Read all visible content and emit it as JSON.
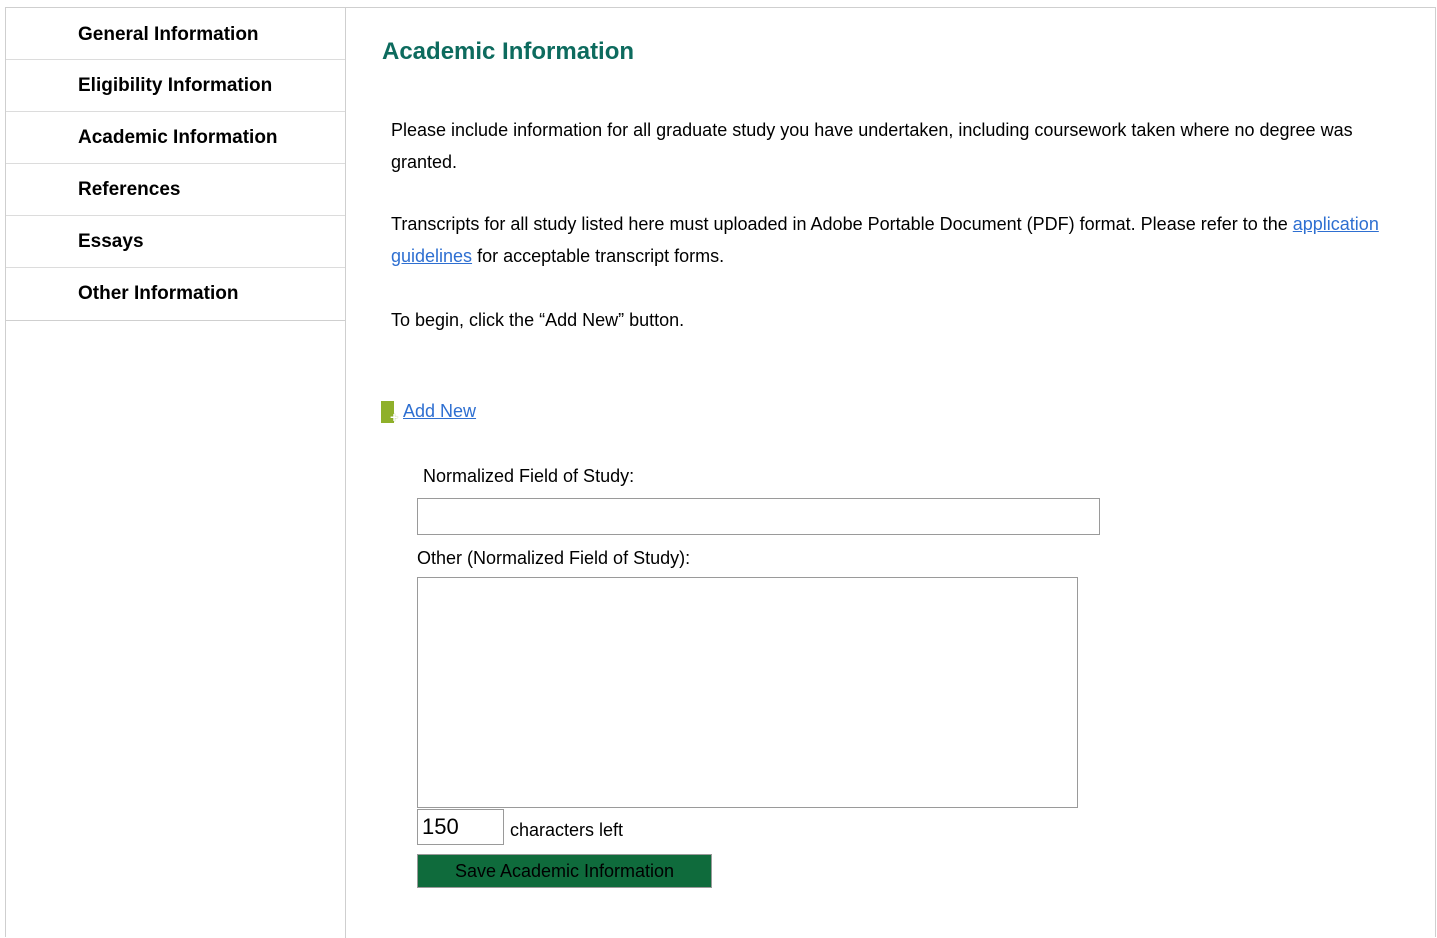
{
  "sidebar": {
    "items": [
      {
        "label": "General Information"
      },
      {
        "label": "Eligibility Information"
      },
      {
        "label": "Academic Information"
      },
      {
        "label": "References"
      },
      {
        "label": "Essays"
      },
      {
        "label": "Other Information"
      }
    ]
  },
  "main": {
    "title": "Academic Information",
    "intro": "Please include information for all graduate study you have undertaken, including coursework taken where no degree was granted.",
    "transcripts_before": "Transcripts for all study listed here must uploaded in Adobe Portable Document (PDF) format. Please refer to the ",
    "transcripts_link": "application guidelines",
    "transcripts_after": " for acceptable transcript forms.",
    "begin_text": "To begin, click the “Add New” button.",
    "add_new_label": "Add New",
    "add_icon": "add-document-icon",
    "field_of_study_label": "Normalized Field of Study:",
    "field_of_study_value": "",
    "other_label": "Other (Normalized Field of Study):",
    "other_value": "",
    "characters_left_value": "150",
    "characters_left_label": "characters left",
    "save_label": "Save Academic Information"
  },
  "colors": {
    "title": "#0d6b5e",
    "link": "#2e6fd1",
    "save_button_bg": "#0f6b3c",
    "add_icon": "#8fb02a",
    "border": "#cfcfcf"
  }
}
